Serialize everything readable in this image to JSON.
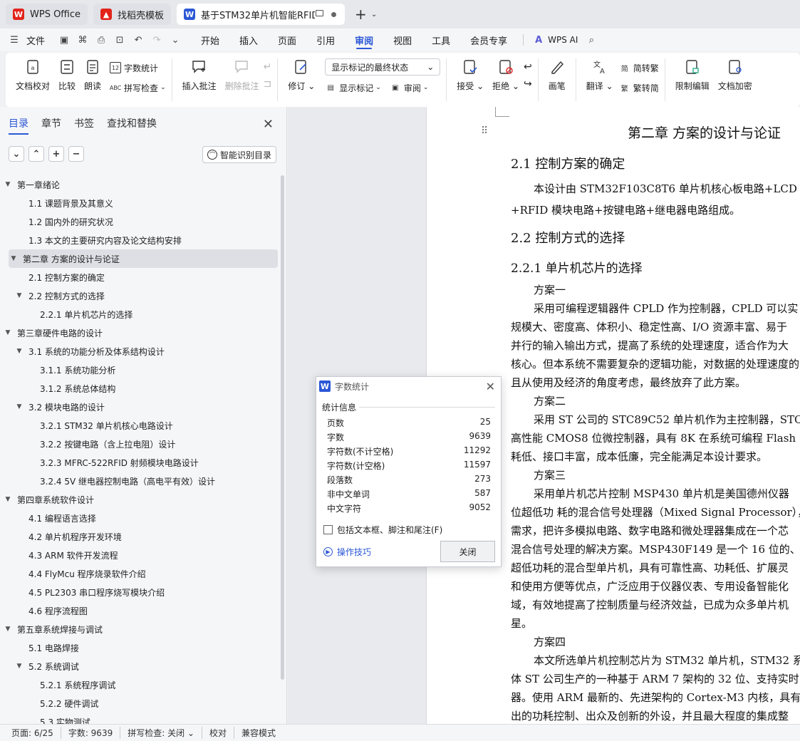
{
  "tabs": [
    {
      "label": "WPS Office",
      "icon": "wps-logo-icon",
      "color": "#e2231a"
    },
    {
      "label": "找稻壳模板",
      "icon": "docer-icon",
      "color": "#e2231a"
    },
    {
      "label": "基于STM32单片机智能RFID房",
      "icon": "word-doc-icon",
      "color": "#2b58d6"
    }
  ],
  "menubar": {
    "file": "文件",
    "items": [
      "开始",
      "插入",
      "页面",
      "引用",
      "审阅",
      "视图",
      "工具",
      "会员专享"
    ],
    "active": "审阅",
    "ai": "WPS AI"
  },
  "ribbon": {
    "doc_proof": "文档校对",
    "compare": "比较",
    "read_aloud": "朗读",
    "word_count": "字数统计",
    "spell_check": "拼写检查",
    "insert_comment": "插入批注",
    "delete_comment": "删除批注",
    "track": "修订",
    "markup_state": "显示标记的最终状态",
    "show_markup": "显示标记",
    "review": "审阅",
    "accept": "接受",
    "reject": "拒绝",
    "pen": "画笔",
    "translate": "翻译",
    "to_traditional": "简转繁",
    "to_simplified": "繁转简",
    "restrict_edit": "限制编辑",
    "doc_encrypt": "文档加密"
  },
  "nav": {
    "tabs": [
      "目录",
      "章节",
      "书签",
      "查找和替换"
    ],
    "active_tab": "目录",
    "smart_toc": "智能识别目录",
    "toc": [
      {
        "label": "第一章绪论",
        "level": 1,
        "expanded": true
      },
      {
        "label": "1.1 课题背景及其意义",
        "level": 2
      },
      {
        "label": "1.2 国内外的研究状况",
        "level": 2
      },
      {
        "label": "1.3 本文的主要研究内容及论文结构安排",
        "level": 2
      },
      {
        "label": "第二章  方案的设计与论证",
        "level": 1,
        "expanded": true,
        "selected": true
      },
      {
        "label": "2.1 控制方案的确定",
        "level": 2
      },
      {
        "label": "2.2 控制方式的选择",
        "level": 2,
        "expanded": true
      },
      {
        "label": "2.2.1  单片机芯片的选择",
        "level": 3
      },
      {
        "label": "第三章硬件电路的设计",
        "level": 1,
        "expanded": true
      },
      {
        "label": "3.1 系统的功能分析及体系结构设计",
        "level": 2,
        "expanded": true
      },
      {
        "label": "3.1.1 系统功能分析",
        "level": 3
      },
      {
        "label": "3.1.2 系统总体结构",
        "level": 3
      },
      {
        "label": "3.2 模块电路的设计",
        "level": 2,
        "expanded": true
      },
      {
        "label": "3.2.1 STM32 单片机核心电路设计",
        "level": 3
      },
      {
        "label": "3.2.2  按键电路（含上拉电阻）设计",
        "level": 3
      },
      {
        "label": "3.2.3 MFRC-522RFID 射频模块电路设计",
        "level": 3
      },
      {
        "label": "3.2.4 5V 继电器控制电路（高电平有效）设计",
        "level": 3
      },
      {
        "label": "第四章系统软件设计",
        "level": 1,
        "expanded": true
      },
      {
        "label": "4.1  编程语言选择",
        "level": 2
      },
      {
        "label": "4.2 单片机程序开发环境",
        "level": 2
      },
      {
        "label": "4.3 ARM 软件开发流程",
        "level": 2
      },
      {
        "label": "4.4 FlyMcu 程序烧录软件介绍",
        "level": 2
      },
      {
        "label": "4.5 PL2303 串口程序烧写模块介绍",
        "level": 2
      },
      {
        "label": "4.6  程序流程图",
        "level": 2
      },
      {
        "label": "第五章系统焊接与调试",
        "level": 1,
        "expanded": true
      },
      {
        "label": "5.1  电路焊接",
        "level": 2
      },
      {
        "label": "5.2  系统调试",
        "level": 2,
        "expanded": true
      },
      {
        "label": "5.2.1  系统程序调试",
        "level": 3
      },
      {
        "label": "5.2.2  硬件调试",
        "level": 3
      },
      {
        "label": "5.3  实物测试",
        "level": 3
      }
    ]
  },
  "document": {
    "chapter_title": "第二章  方案的设计与论证",
    "h_2_1": "2.1 控制方案的确定",
    "p_2_1_a": "本设计由 STM32F103C8T6 单片机核心板电路+LCD",
    "p_2_1_b": "+RFID 模块电路+按键电路+继电器电路组成。",
    "h_2_2": "2.2 控制方式的选择",
    "h_2_2_1": "2.2.1  单片机芯片的选择",
    "s1": "方案一",
    "s1_l1": "采用可编程逻辑器件 CPLD 作为控制器，CPLD 可以实",
    "s1_l2": "规模大、密度高、体积小、稳定性高、I/O 资源丰富、易于",
    "s1_l3": "并行的输入输出方式，提高了系统的处理速度，适合作为大",
    "s1_l4": "核心。但本系统不需要复杂的逻辑功能，对数据的处理速度的",
    "s1_l5": "且从使用及经济的角度考虑，最终放弃了此方案。",
    "s2": "方案二",
    "s2_l1": "采用 ST 公司的 STC89C52 单片机作为主控制器，STC",
    "s2_l2": "高性能 CMOS8 位微控制器，具有 8K 在系统可编程 Flash",
    "s2_l3": "耗低、接口丰富，成本低廉，完全能满足本设计要求。",
    "s3": "方案三",
    "s3_l1": "采用单片机芯片控制 MSP430 单片机是美国德州仪器",
    "s3_l2": "位超低功 耗的混合信号处理器（Mixed Signal Processor），",
    "s3_l3": "需求，把许多模拟电路、数字电路和微处理器集成在一个芯",
    "s3_l4": "混合信号处理的解决方案。MSP430F149 是一个 16 位的、",
    "s3_l5": "超低功耗的混合型单片机，具有可靠性高、功耗低、扩展灵",
    "s3_l6": "和使用方便等优点，广泛应用于仪器仪表、专用设备智能化",
    "s3_l7": "域，有效地提高了控制质量与经济效益，已成为众多单片机",
    "s3_l8": "星。",
    "s4": "方案四",
    "s4_l1": "本文所选单片机控制芯片为 STM32 单片机，STM32 系",
    "s4_l2": "体 ST 公司生产的一种基于 ARM 7 架构的 32 位、支持实时",
    "s4_l3": "器。使用 ARM 最新的、先进架构的 Cortex-M3 内核，具有",
    "s4_l4": "出的功耗控制、出众及创新的外设，并且最大程度的集成整"
  },
  "dialog": {
    "title": "字数统计",
    "section": "统计信息",
    "stats": [
      {
        "label": "页数",
        "value": "25"
      },
      {
        "label": "字数",
        "value": "9639"
      },
      {
        "label": "字符数(不计空格)",
        "value": "11292"
      },
      {
        "label": "字符数(计空格)",
        "value": "11597"
      },
      {
        "label": "段落数",
        "value": "273"
      },
      {
        "label": "非中文单词",
        "value": "587"
      },
      {
        "label": "中文字符",
        "value": "9052"
      }
    ],
    "checkbox": "包括文本框、脚注和尾注(F)",
    "tips": "操作技巧",
    "close": "关闭"
  },
  "status": {
    "page": "页面: 6/25",
    "words": "字数: 9639",
    "spell": "拼写检查: 关闭",
    "proof": "校对",
    "compat": "兼容模式"
  }
}
